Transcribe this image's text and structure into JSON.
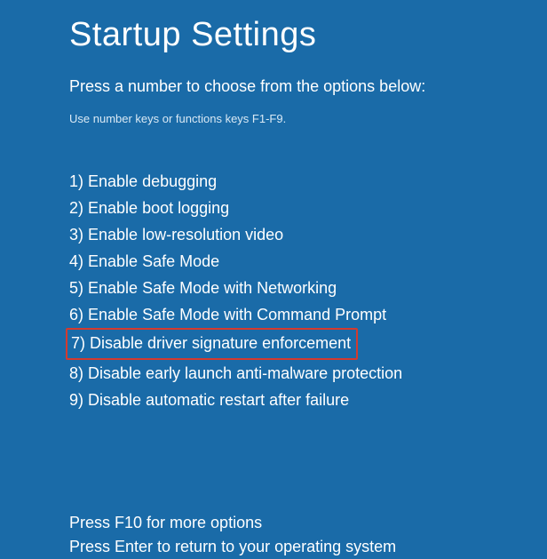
{
  "title": "Startup Settings",
  "subtitle": "Press a number to choose from the options below:",
  "hint": "Use number keys or functions keys F1-F9.",
  "options": [
    {
      "num": "1",
      "label": "Enable debugging",
      "highlighted": false
    },
    {
      "num": "2",
      "label": "Enable boot logging",
      "highlighted": false
    },
    {
      "num": "3",
      "label": "Enable low-resolution video",
      "highlighted": false
    },
    {
      "num": "4",
      "label": "Enable Safe Mode",
      "highlighted": false
    },
    {
      "num": "5",
      "label": "Enable Safe Mode with Networking",
      "highlighted": false
    },
    {
      "num": "6",
      "label": "Enable Safe Mode with Command Prompt",
      "highlighted": false
    },
    {
      "num": "7",
      "label": "Disable driver signature enforcement",
      "highlighted": true
    },
    {
      "num": "8",
      "label": "Disable early launch anti-malware protection",
      "highlighted": false
    },
    {
      "num": "9",
      "label": "Disable automatic restart after failure",
      "highlighted": false
    }
  ],
  "footer": {
    "line1": "Press F10 for more options",
    "line2": "Press Enter to return to your operating system"
  },
  "colors": {
    "background": "#1a6ba8",
    "highlight_border": "#d43a2e"
  }
}
